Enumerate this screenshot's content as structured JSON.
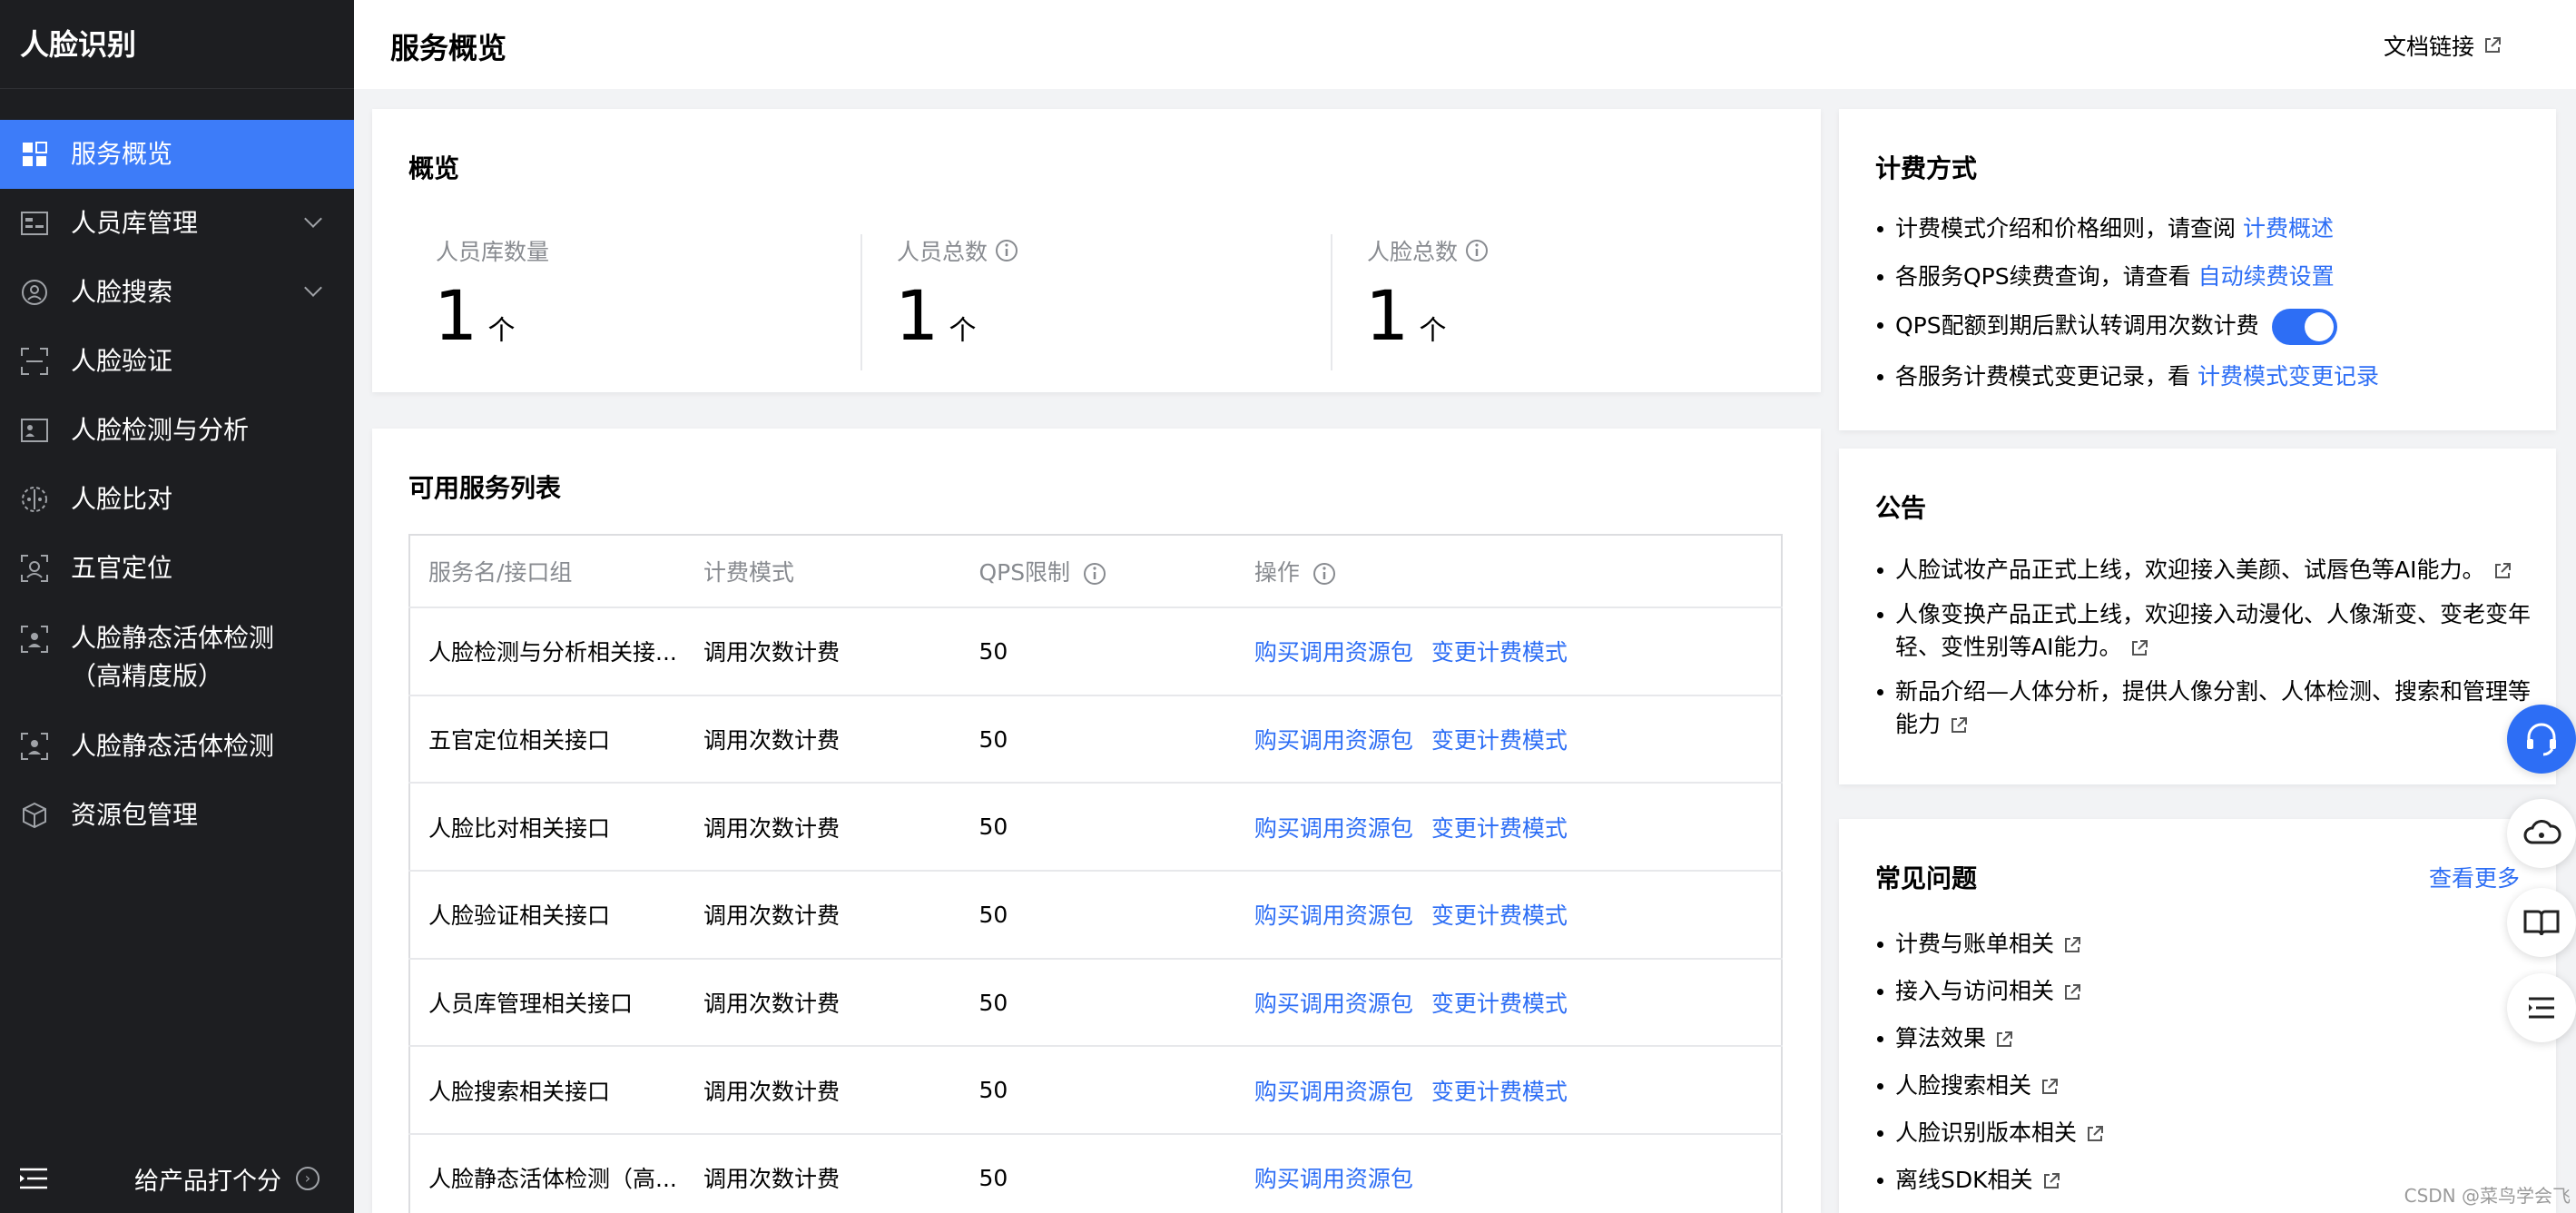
{
  "sidebar": {
    "product_title": "人脸识别",
    "items": [
      {
        "label": "服务概览",
        "icon": "dashboard-icon",
        "active": true
      },
      {
        "label": "人员库管理",
        "icon": "id-card-icon",
        "expandable": true
      },
      {
        "label": "人脸搜索",
        "icon": "face-search-icon",
        "expandable": true
      },
      {
        "label": "人脸验证",
        "icon": "face-scan-icon"
      },
      {
        "label": "人脸检测与分析",
        "icon": "portrait-icon"
      },
      {
        "label": "人脸比对",
        "icon": "compare-icon"
      },
      {
        "label": "五官定位",
        "icon": "face-landmark-icon"
      },
      {
        "label": "人脸静态活体检测",
        "label_line2": "（高精度版）",
        "icon": "liveness-icon"
      },
      {
        "label": "人脸静态活体检测",
        "icon": "liveness-icon"
      },
      {
        "label": "资源包管理",
        "icon": "package-icon"
      }
    ],
    "footer": {
      "rate_label": "给产品打个分"
    }
  },
  "header": {
    "title": "服务概览",
    "doc_link": "文档链接"
  },
  "overview": {
    "title": "概览",
    "stats": [
      {
        "label": "人员库数量",
        "value": "1",
        "unit": "个",
        "info": false
      },
      {
        "label": "人员总数",
        "value": "1",
        "unit": "个",
        "info": true
      },
      {
        "label": "人脸总数",
        "value": "1",
        "unit": "个",
        "info": true
      }
    ]
  },
  "services": {
    "title": "可用服务列表",
    "columns": [
      "服务名/接口组",
      "计费模式",
      "QPS限制",
      "操作"
    ],
    "rows": [
      {
        "name": "人脸检测与分析相关接...",
        "billing": "调用次数计费",
        "qps": "50",
        "actions": [
          "购买调用资源包",
          "变更计费模式"
        ]
      },
      {
        "name": "五官定位相关接口",
        "billing": "调用次数计费",
        "qps": "50",
        "actions": [
          "购买调用资源包",
          "变更计费模式"
        ]
      },
      {
        "name": "人脸比对相关接口",
        "billing": "调用次数计费",
        "qps": "50",
        "actions": [
          "购买调用资源包",
          "变更计费模式"
        ]
      },
      {
        "name": "人脸验证相关接口",
        "billing": "调用次数计费",
        "qps": "50",
        "actions": [
          "购买调用资源包",
          "变更计费模式"
        ]
      },
      {
        "name": "人员库管理相关接口",
        "billing": "调用次数计费",
        "qps": "50",
        "actions": [
          "购买调用资源包",
          "变更计费模式"
        ]
      },
      {
        "name": "人脸搜索相关接口",
        "billing": "调用次数计费",
        "qps": "50",
        "actions": [
          "购买调用资源包",
          "变更计费模式"
        ]
      },
      {
        "name": "人脸静态活体检测（高...",
        "billing": "调用次数计费",
        "qps": "50",
        "actions": [
          "购买调用资源包"
        ]
      }
    ]
  },
  "billing": {
    "title": "计费方式",
    "items": [
      {
        "text": "计费模式介绍和价格细则，请查阅 ",
        "link": "计费概述"
      },
      {
        "text": "各服务QPS续费查询，请查看 ",
        "link": "自动续费设置"
      },
      {
        "text": "QPS配额到期后默认转调用次数计费",
        "toggle_on": true
      },
      {
        "text": "各服务计费模式变更记录，看 ",
        "link": "计费模式变更记录"
      }
    ]
  },
  "notice": {
    "title": "公告",
    "items": [
      "人脸试妆产品正式上线，欢迎接入美颜、试唇色等AI能力。",
      "人像变换产品正式上线，欢迎接入动漫化、人像渐变、变老变年轻、变性别等AI能力。",
      "新品介绍—人体分析，提供人像分割、人体检测、搜索和管理等能力"
    ]
  },
  "faq": {
    "title": "常见问题",
    "more": "查看更多",
    "items": [
      "计费与账单相关",
      "接入与访问相关",
      "算法效果",
      "人脸搜索相关",
      "人脸识别版本相关",
      "离线SDK相关"
    ]
  },
  "watermark": "CSDN @菜鸟学会飞",
  "colors": {
    "accent": "#2d6ef5",
    "sidebar_bg": "#1d1e21",
    "sidebar_active": "#3d7cf9"
  }
}
